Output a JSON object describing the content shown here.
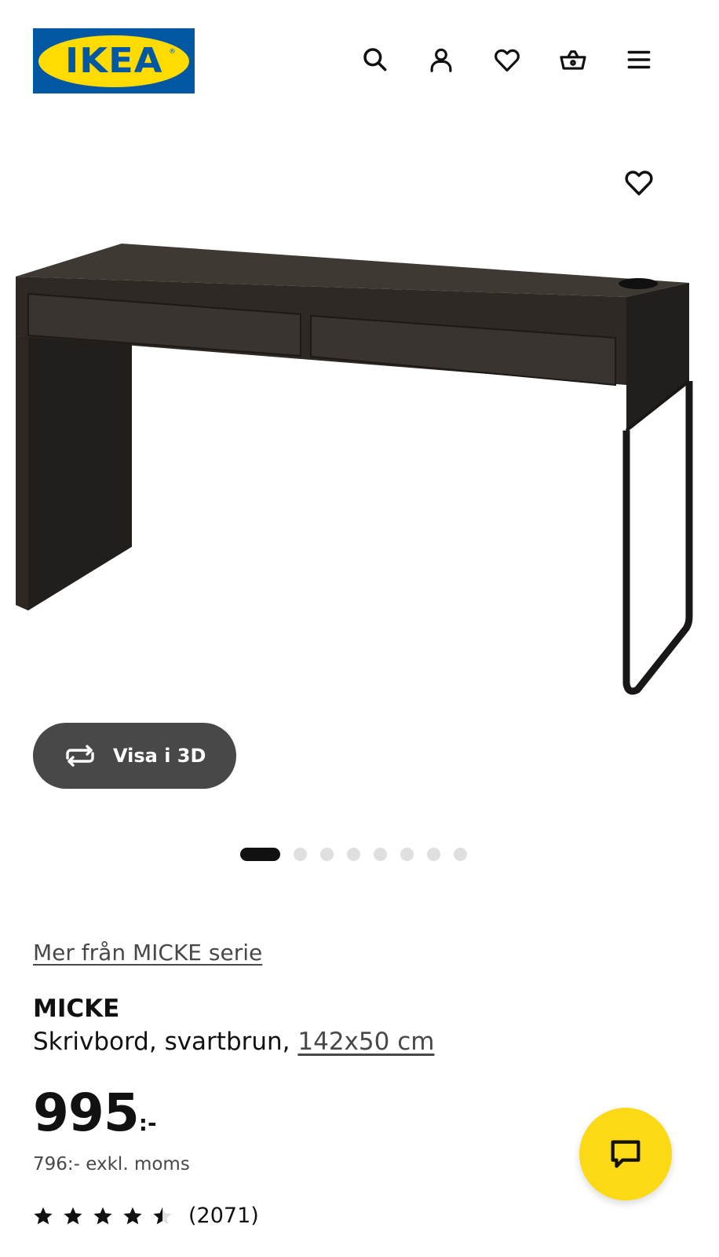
{
  "header": {
    "logo_text": "IKEA",
    "logo_reg": "®",
    "icons": [
      "search-icon",
      "user-icon",
      "heart-icon",
      "basket-icon",
      "menu-icon"
    ]
  },
  "gallery": {
    "view_3d_label": "Visa i 3D",
    "image_count": 8,
    "active_index": 0
  },
  "product": {
    "series_link": "Mer från MICKE serie",
    "name": "MICKE",
    "description": "Skrivbord, svartbrun, ",
    "size": "142x50 cm",
    "price_integer": "995",
    "price_suffix": ":-",
    "price_excl": "796:- exkl. moms",
    "rating": 4.5,
    "review_count": "(2071)"
  },
  "colors": {
    "ikea_blue": "#0058a3",
    "ikea_yellow": "#ffdb00",
    "chat_yellow": "#fbd914",
    "button_dark": "#484848"
  }
}
